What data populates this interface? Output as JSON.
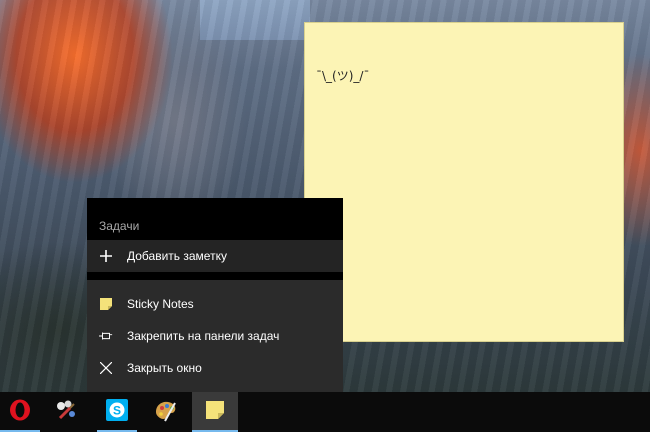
{
  "note": {
    "text": "¯\\_(ツ)_/¯",
    "background": "#fcf4b5"
  },
  "jump_list": {
    "section_header": "Задачи",
    "items": [
      {
        "label": "Добавить заметку",
        "icon": "plus-icon"
      },
      {
        "label": "Sticky Notes",
        "icon": "sticky-notes-icon"
      },
      {
        "label": "Закрепить на панели задач",
        "icon": "pin-icon"
      },
      {
        "label": "Закрыть окно",
        "icon": "close-icon"
      }
    ]
  },
  "taskbar": {
    "apps": [
      {
        "name": "opera-icon",
        "accent": "#e0121f"
      },
      {
        "name": "paint-brush-icon",
        "accent": "#c93a3a"
      },
      {
        "name": "skype-icon",
        "accent": "#00aff0"
      },
      {
        "name": "palette-icon",
        "accent": "#d7a24a"
      },
      {
        "name": "sticky-notes-icon",
        "accent": "#f4e27a"
      }
    ],
    "accent": "#76b9ed"
  }
}
